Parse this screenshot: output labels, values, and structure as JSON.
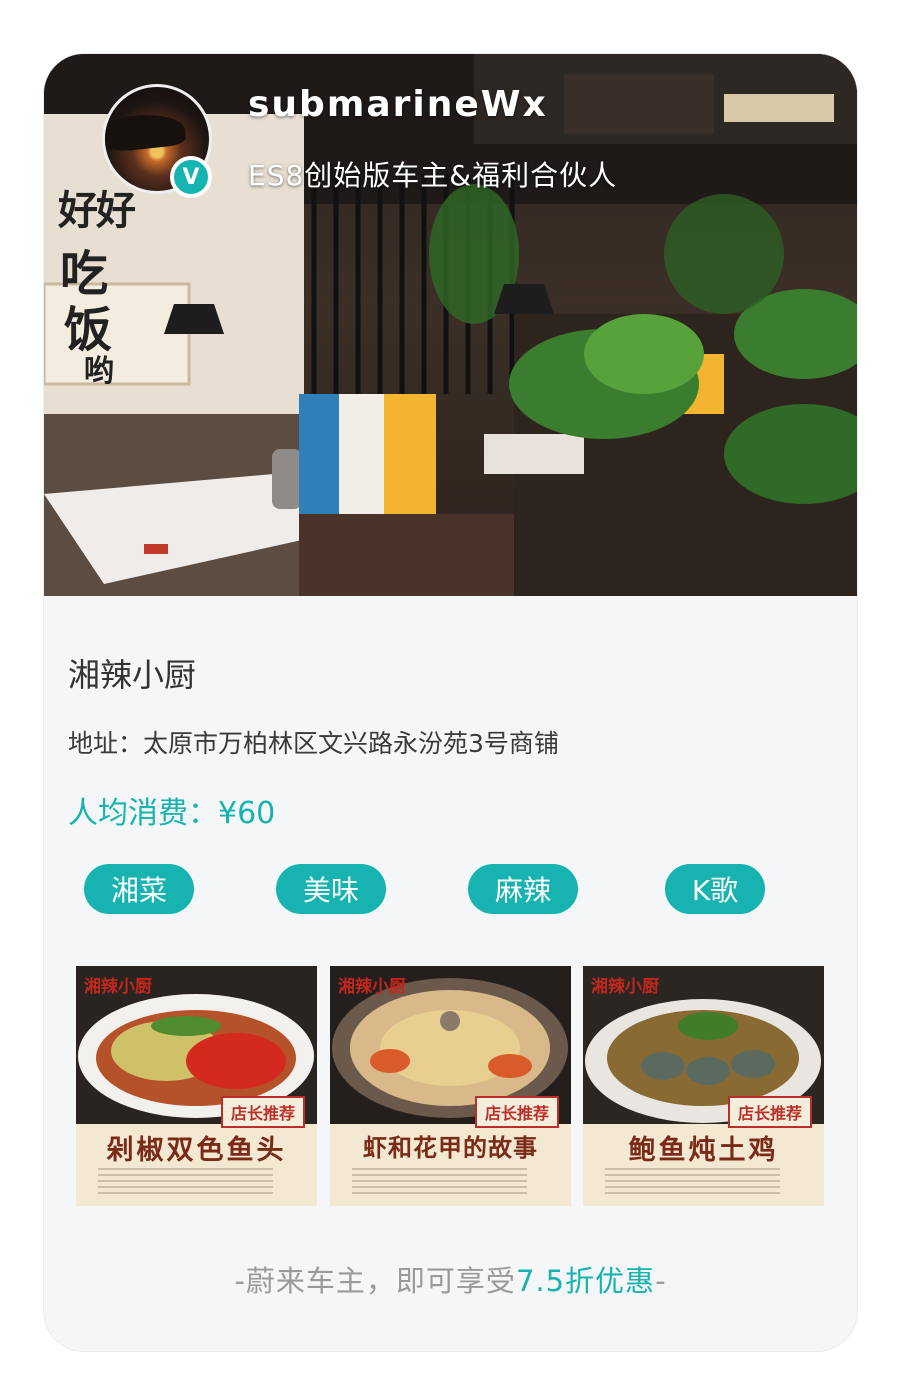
{
  "user": {
    "name": "submarineWx",
    "title": "ES8创始版车主&福利合伙人",
    "verified_mark": "V"
  },
  "hero": {
    "wall_text": [
      "好",
      "好",
      "吃",
      "饭",
      "哟"
    ]
  },
  "shop": {
    "name": "湘辣小厨",
    "address": "地址：太原市万柏林区文兴路永汾苑3号商铺",
    "price": "人均消费：¥60"
  },
  "tags": [
    "湘菜",
    "美味",
    "麻辣",
    "K歌"
  ],
  "dishes": [
    {
      "name": "剁椒双色鱼头",
      "badge": "店长推荐",
      "logo": "湘辣小厨"
    },
    {
      "name": "虾和花甲的故事",
      "badge": "店长推荐",
      "logo": "湘辣小厨"
    },
    {
      "name": "鲍鱼炖土鸡",
      "badge": "店长推荐",
      "logo": "湘辣小厨"
    }
  ],
  "footer": {
    "prefix": "-蔚来车主，即可享受",
    "highlight": "7.5折优惠",
    "suffix": "-"
  },
  "colors": {
    "accent": "#16b3b0",
    "card_bg": "#f5f6f7"
  }
}
